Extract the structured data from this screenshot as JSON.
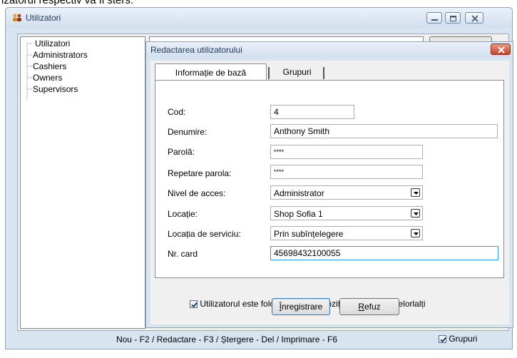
{
  "top_caption": "izatorul respectiv va fi sters.",
  "main_window": {
    "title": "Utilizatori",
    "tree": {
      "root": "Utilizatori",
      "children": [
        "Administrators",
        "Cashiers",
        "Owners",
        "Supervisors"
      ]
    },
    "status_bar": "Nou - F2 / Redactare - F3 / Ștergere - Del / Imprimare - F6",
    "grupuri_label": "Grupuri",
    "grupuri_checked": true
  },
  "dialog": {
    "title": "Redactarea utilizatorului",
    "tabs": [
      {
        "label": "Informație de bază",
        "active": true
      },
      {
        "label": "Grupuri",
        "active": false
      }
    ],
    "fields": {
      "cod": {
        "label": "Cod:",
        "value": "4"
      },
      "denumire": {
        "label": "Denumire:",
        "value": "Anthony Smith"
      },
      "parola": {
        "label": "Parolă:",
        "value": "****"
      },
      "repetare_parola": {
        "label": "Repetare parola:",
        "value": "****"
      },
      "nivel_acces": {
        "label": "Nivel de acces:",
        "value": "Administrator"
      },
      "locatie": {
        "label": "Locație:",
        "value": "Shop Sofia 1"
      },
      "locatie_serviciu": {
        "label": "Locația de serviciu:",
        "value": "Prin subînțelegere"
      },
      "nr_card": {
        "label": "Nr. card",
        "value": "45698432100055"
      }
    },
    "frequent_checkbox_label": "Utilizatorul este folosit des, va fi poziționat înaintea celorlalți",
    "frequent_checked": true,
    "save_button": {
      "mnemonic": "Î",
      "rest": "nregistrare"
    },
    "cancel_button": {
      "mnemonic": "R",
      "rest": "efuz"
    }
  },
  "colors": {
    "frame": "#d9e4f1",
    "title_text": "#1e395b",
    "close_button": "#c8432b",
    "focus_border": "#3399ff"
  }
}
